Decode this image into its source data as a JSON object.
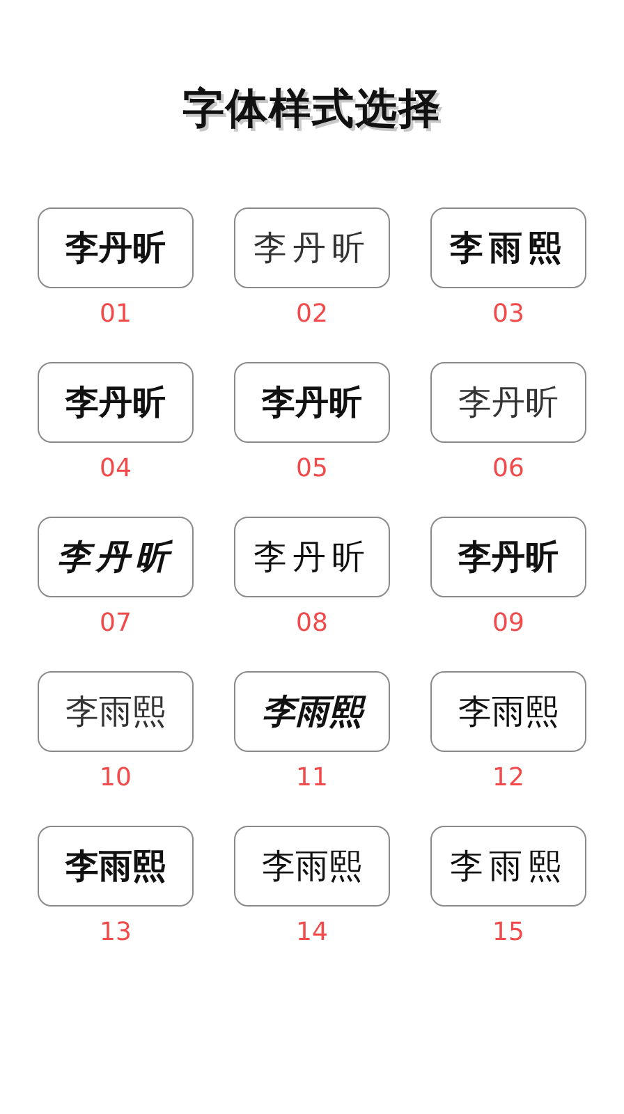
{
  "title": "字体样式选择",
  "styles": [
    {
      "sample": "李丹昕",
      "number": "01"
    },
    {
      "sample": "李丹昕",
      "number": "02"
    },
    {
      "sample": "李雨熙",
      "number": "03"
    },
    {
      "sample": "李丹昕",
      "number": "04"
    },
    {
      "sample": "李丹昕",
      "number": "05"
    },
    {
      "sample": "李丹昕",
      "number": "06"
    },
    {
      "sample": "李丹昕",
      "number": "07"
    },
    {
      "sample": "李丹昕",
      "number": "08"
    },
    {
      "sample": "李丹昕",
      "number": "09"
    },
    {
      "sample": "李雨熙",
      "number": "10"
    },
    {
      "sample": "李雨熙",
      "number": "11"
    },
    {
      "sample": "李雨熙",
      "number": "12"
    },
    {
      "sample": "李雨熙",
      "number": "13"
    },
    {
      "sample": "李雨熙",
      "number": "14"
    },
    {
      "sample": "李雨熙",
      "number": "15"
    }
  ]
}
